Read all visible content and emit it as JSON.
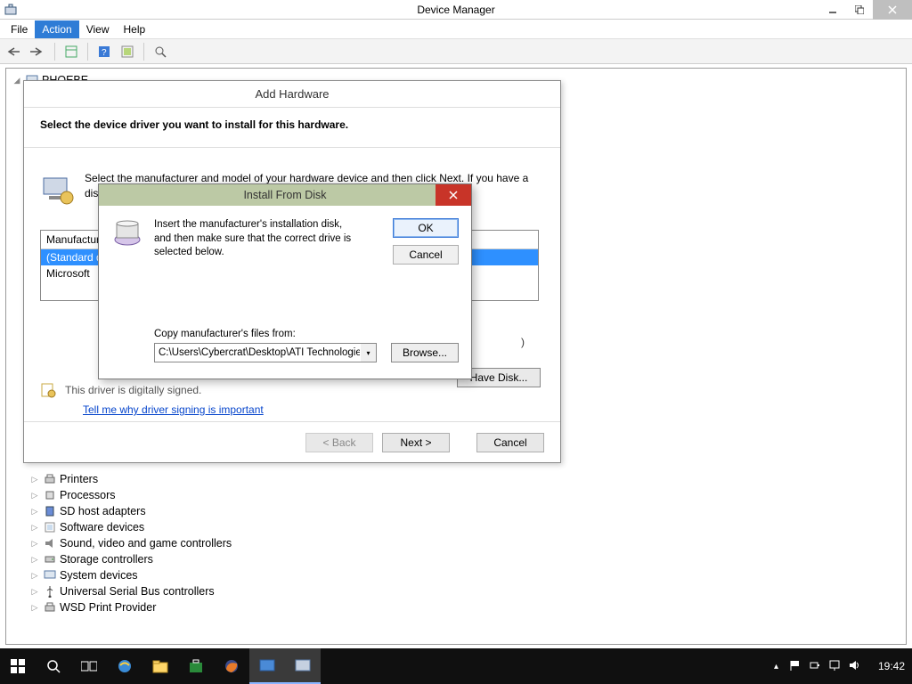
{
  "window": {
    "title": "Device Manager"
  },
  "menu": {
    "file": "File",
    "action": "Action",
    "view": "View",
    "help": "Help"
  },
  "tree": {
    "root": "PHOEBE",
    "items": [
      "Printers",
      "Processors",
      "SD host adapters",
      "Software devices",
      "Sound, video and game controllers",
      "Storage controllers",
      "System devices",
      "Universal Serial Bus controllers",
      "WSD Print Provider"
    ]
  },
  "addhw": {
    "title": "Add Hardware",
    "heading": "Select the device driver you want to install for this hardware.",
    "instructions": "Select the manufacturer and model of your hardware device and then click Next. If you have a disk that contains the driver you want to install, click Have Disk.",
    "manufacturer_header": "Manufacturer",
    "row_selected": "(Standard display types)",
    "row_other": "Microsoft",
    "digital": "This driver is digitally signed.",
    "link": "Tell me why driver signing is important",
    "have_disk": "Have Disk...",
    "back": "< Back",
    "next": "Next >",
    "cancel": "Cancel",
    "hidden_paren": ")"
  },
  "ifd": {
    "title": "Install From Disk",
    "message": "Insert the manufacturer's installation disk, and then make sure that the correct drive is selected below.",
    "ok": "OK",
    "cancel": "Cancel",
    "copy_label": "Copy manufacturer's files from:",
    "path": "C:\\Users\\Cybercrat\\Desktop\\ATI Technologies Inc",
    "browse": "Browse..."
  },
  "taskbar": {
    "clock": "19:42"
  }
}
